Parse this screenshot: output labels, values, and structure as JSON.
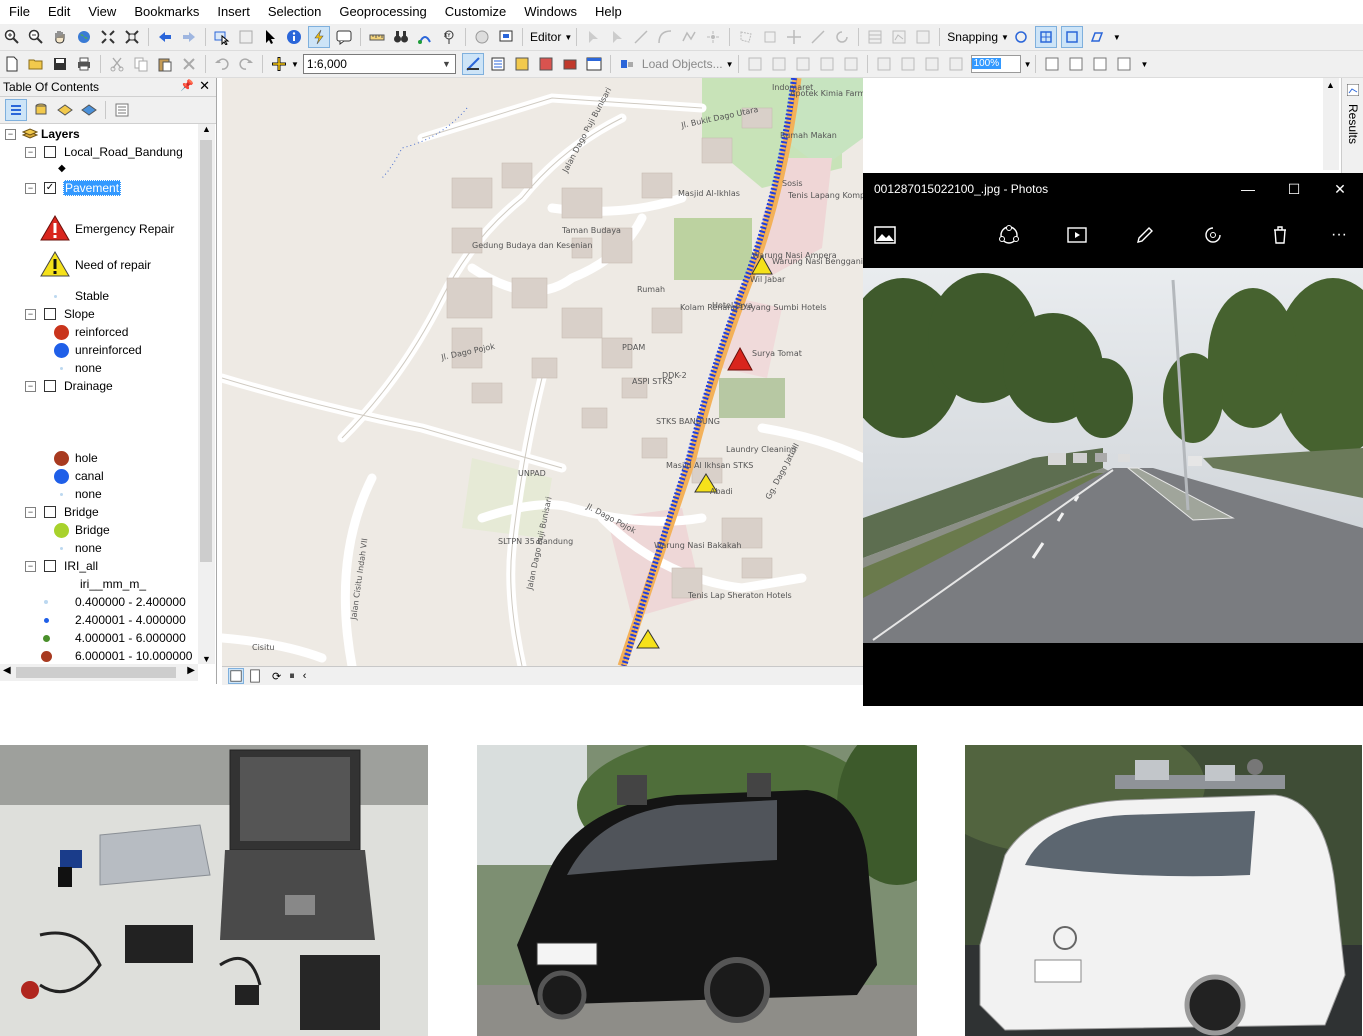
{
  "menu": [
    "File",
    "Edit",
    "View",
    "Bookmarks",
    "Insert",
    "Selection",
    "Geoprocessing",
    "Customize",
    "Windows",
    "Help"
  ],
  "toolbar1": {
    "editor_label": "Editor",
    "snapping_label": "Snapping"
  },
  "toolbar2": {
    "scale_value": "1:6,000",
    "load_objects_label": "Load Objects...",
    "zoom_percent": "100%"
  },
  "toc": {
    "title": "Table Of Contents",
    "root_label": "Layers",
    "layers": [
      {
        "name": "Local_Road_Bandung",
        "checked": false
      },
      {
        "name": "Pavement",
        "checked": true,
        "selected": true,
        "legend": [
          "Emergency Repair",
          "Need of repair",
          "Stable"
        ]
      },
      {
        "name": "Slope",
        "checked": false,
        "legend": [
          "reinforced",
          "unreinforced",
          "none"
        ]
      },
      {
        "name": "Drainage",
        "checked": false,
        "legend": [
          "hole",
          "canal",
          "none"
        ]
      },
      {
        "name": "Bridge",
        "checked": false,
        "legend": [
          "Bridge",
          "none"
        ]
      },
      {
        "name": "IRI_all",
        "checked": false,
        "field": "iri__mm_m_",
        "legend": [
          "0.400000 - 2.400000",
          "2.400001 - 4.000000",
          "4.000001 - 6.000000",
          "6.000001 - 10.000000"
        ]
      }
    ],
    "colors": {
      "reinforced": "#c9341c",
      "unreinforced": "#1f5fe8",
      "hole": "#a83a20",
      "canal": "#1f5fe8",
      "bridge": "#a8d22c"
    }
  },
  "map": {
    "labels": [
      "Jl. Bukit Dago Utara",
      "Jalan Dago Puji Bunisari",
      "Masjid Al-Ikhlas",
      "Taman Budaya",
      "Gedung Budaya dan Kesenian",
      "Warung Nasi Ampera",
      "Jl. Dago Pojok",
      "PDAM",
      "DDK-2",
      "ASPI STKS",
      "STKS BANDUNG",
      "Masjid Al Ikhsan STKS",
      "UNPAD",
      "Jl. Dago Pojok",
      "SLTPN 35 Bandung",
      "Jalan Dago Puji Bunisari",
      "Jalan Cisitu Indah VII",
      "Gg. Dago Jati III",
      "Tenis Lapang Komp Dosen UNPAD",
      "Tenis Lap Sheraton Hotels",
      "Warung Nasi Bakakah",
      "Kolam Renang Dayang Sumbi Hotels",
      "Hotel Jaya",
      "Surya Tomat",
      "Laundry Cleaning",
      "Cisitu",
      "Rumah Makan",
      "Apotek Kimia Farma",
      "Indomaret",
      "Sosis",
      "Wil Jabar",
      "Warung Nasi Bengganis",
      "Rumah",
      "Abadi"
    ],
    "route_color": "#1f3fe0"
  },
  "photos_window": {
    "title": "001287015022100_.jpg - Photos",
    "controls": [
      "minimize",
      "maximize",
      "close"
    ],
    "tools": [
      "image-icon",
      "enhance-icon",
      "slideshow-icon",
      "edit-icon",
      "rotate-icon",
      "delete-icon",
      "more-icon"
    ]
  },
  "results_label": "Results"
}
